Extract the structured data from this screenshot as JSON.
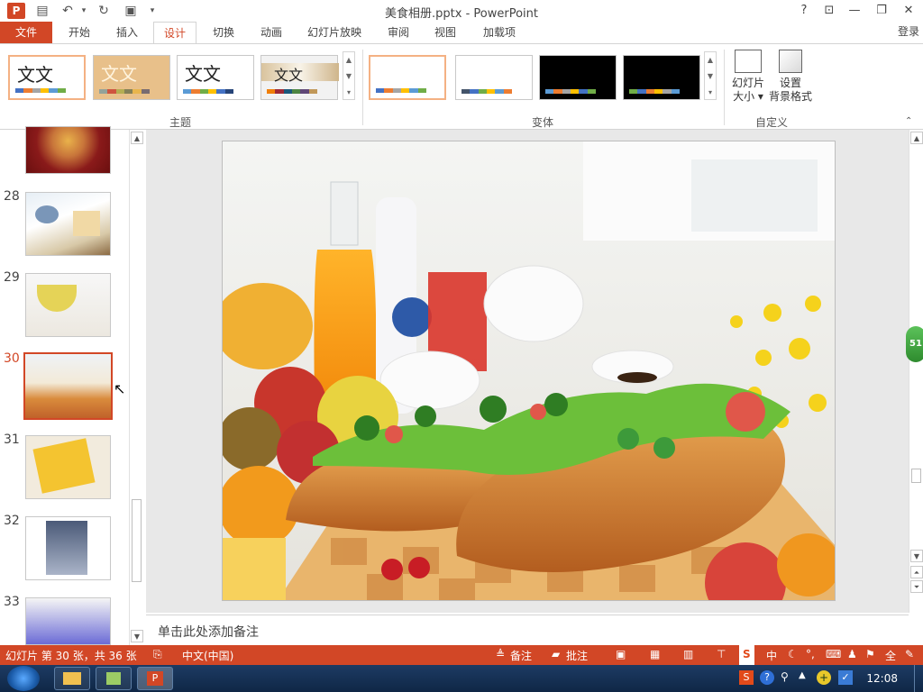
{
  "window": {
    "title": "美食相册.pptx - PowerPoint",
    "app_icon": "P"
  },
  "titlebar": {
    "help": "?",
    "restore_ribbon": "⊡",
    "minimize": "—",
    "maximize": "❐",
    "close": "✕"
  },
  "tabs": [
    "文件",
    "开始",
    "插入",
    "设计",
    "切换",
    "动画",
    "幻灯片放映",
    "审阅",
    "视图",
    "加载项"
  ],
  "login": "登录",
  "ribbon": {
    "themes": [
      {
        "label": "文文",
        "bg": "#ffffff"
      },
      {
        "label": "文文",
        "bg": "#e8c08a"
      },
      {
        "label": "文文",
        "bg": "#ffffff"
      },
      {
        "label": "文文",
        "bg": "#f2f2f2"
      }
    ],
    "themes_group": "主题",
    "variants_group": "变体",
    "customize_group": "自定义",
    "slide_size_label": "幻灯片\n大小",
    "slide_size_l1": "幻灯片",
    "slide_size_l2": "大小",
    "bg_format_l1": "设置",
    "bg_format_l2": "背景格式"
  },
  "thumbnails": [
    {
      "num": "",
      "name": "pizza"
    },
    {
      "num": "28",
      "name": "cake"
    },
    {
      "num": "29",
      "name": "soup"
    },
    {
      "num": "30",
      "name": "sandwich",
      "selected": true
    },
    {
      "num": "31",
      "name": "tray"
    },
    {
      "num": "32",
      "name": "icecream"
    },
    {
      "num": "33",
      "name": "breakfast"
    }
  ],
  "notes_placeholder": "单击此处添加备注",
  "status": {
    "slide_info": "幻灯片 第 30 张，共 36 张",
    "language": "中文(中国)",
    "notes": "备注",
    "comments": "批注"
  },
  "taskbar": {
    "clock": "12:08"
  },
  "zoom_badge": "51",
  "colors": {
    "accent": "#d24726",
    "taskbar": "#1d3b63"
  }
}
